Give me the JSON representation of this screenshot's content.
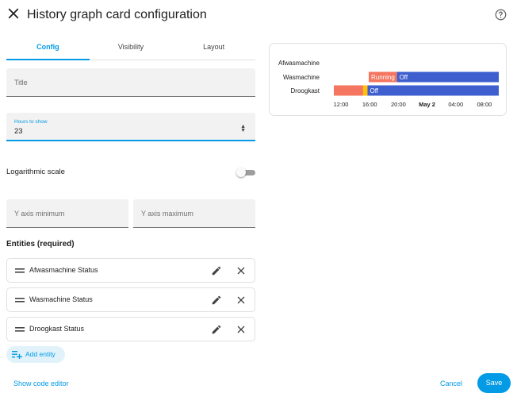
{
  "dialog": {
    "title": "History graph card configuration",
    "close_icon": "close-icon",
    "help_icon": "help-circle-icon"
  },
  "tabs": [
    {
      "label": "Config",
      "active": true
    },
    {
      "label": "Visibility",
      "active": false
    },
    {
      "label": "Layout",
      "active": false
    }
  ],
  "form": {
    "title_placeholder": "Title",
    "hours_label": "Hours to show",
    "hours_value": "23",
    "log_scale_label": "Logarithmic scale",
    "log_scale_on": false,
    "y_min_placeholder": "Y axis minimum",
    "y_max_placeholder": "Y axis maximum"
  },
  "entities": {
    "heading": "Entities (required)",
    "items": [
      {
        "name": "Afwasmachine Status"
      },
      {
        "name": "Wasmachine Status"
      },
      {
        "name": "Droogkast Status"
      }
    ],
    "add_label": "Add entity"
  },
  "footer": {
    "code_editor_label": "Show code editor",
    "cancel_label": "Cancel",
    "save_label": "Save"
  },
  "colors": {
    "accent": "#039be5",
    "state_running": "#f47560",
    "state_off": "#3f5fcf",
    "state_other": "#ffc107"
  },
  "chart_data": {
    "type": "timeline",
    "rows": [
      {
        "name": "Afwasmachine",
        "segments": []
      },
      {
        "name": "Wasmachine",
        "segments": [
          {
            "state": "Running",
            "start": "15:52",
            "end": "19:48",
            "color": "#f47560"
          },
          {
            "state": "Off",
            "start": "19:48",
            "end": "10:00",
            "color": "#3f5fcf"
          }
        ]
      },
      {
        "name": "Droogkast",
        "segments": [
          {
            "state": "",
            "start": "11:00",
            "end": "15:05",
            "color": "#f47560"
          },
          {
            "state": "",
            "start": "15:05",
            "end": "15:42",
            "color": "#ffc107"
          },
          {
            "state": "Off",
            "start": "15:42",
            "end": "10:00",
            "color": "#3f5fcf"
          }
        ]
      }
    ],
    "x_ticks": [
      {
        "label": "12:00",
        "bold": false
      },
      {
        "label": "16:00",
        "bold": false
      },
      {
        "label": "20:00",
        "bold": false
      },
      {
        "label": "May 2",
        "bold": true
      },
      {
        "label": "04:00",
        "bold": false
      },
      {
        "label": "08:00",
        "bold": false
      }
    ]
  }
}
